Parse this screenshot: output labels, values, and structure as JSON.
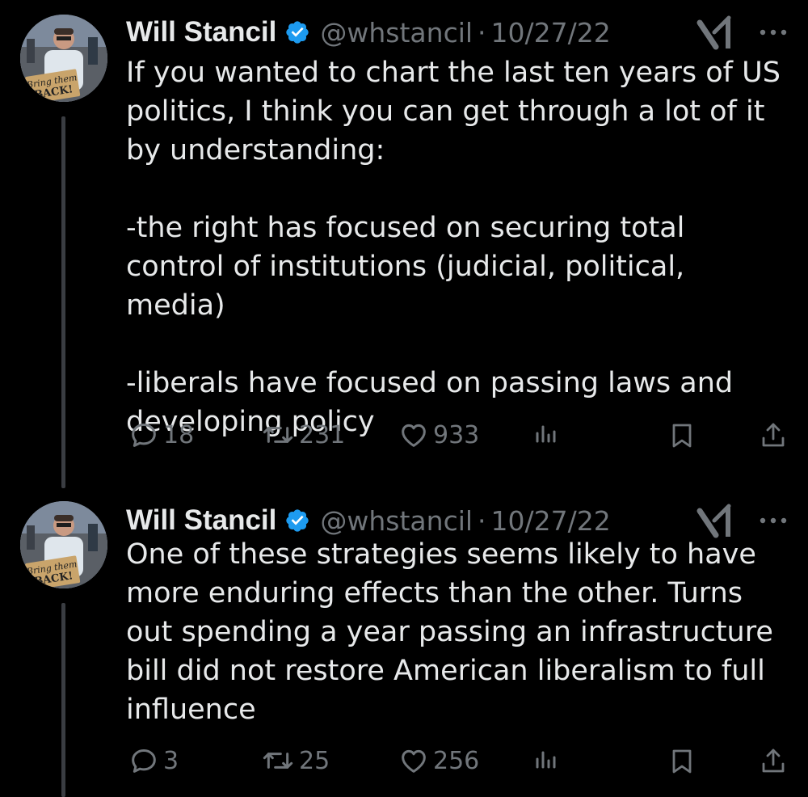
{
  "thread": [
    {
      "author": {
        "name": "Will Stancil",
        "handle": "@whstancil",
        "verified": true,
        "avatar_sign_text": "Bring them BACK!"
      },
      "separator": "·",
      "date": "10/27/22",
      "text": "If you wanted to chart the last ten years of US politics, I think you can get through a lot of it by understanding:\n\n-the right has focused on securing total control of institutions (judicial, political, media)\n\n-liberals have focused on passing laws and developing policy",
      "stats": {
        "replies": "18",
        "retweets": "231",
        "likes": "933"
      },
      "icons": [
        "grok-icon",
        "more-icon",
        "reply-icon",
        "retweet-icon",
        "like-icon",
        "views-icon",
        "bookmark-icon",
        "share-icon"
      ]
    },
    {
      "author": {
        "name": "Will Stancil",
        "handle": "@whstancil",
        "verified": true,
        "avatar_sign_text": "Bring them BACK!"
      },
      "separator": "·",
      "date": "10/27/22",
      "text": "One of these strategies seems likely to have more enduring effects than the other. Turns out spending a year passing an infrastructure bill did not restore American liberalism to full influence",
      "stats": {
        "replies": "3",
        "retweets": "25",
        "likes": "256"
      },
      "icons": [
        "grok-icon",
        "more-icon",
        "reply-icon",
        "retweet-icon",
        "like-icon",
        "views-icon",
        "bookmark-icon",
        "share-icon"
      ]
    }
  ],
  "colors": {
    "background": "#000000",
    "text": "#e7e9ea",
    "muted": "#71767b",
    "verified": "#1d9bf0",
    "thread_line": "#3a3d42"
  }
}
